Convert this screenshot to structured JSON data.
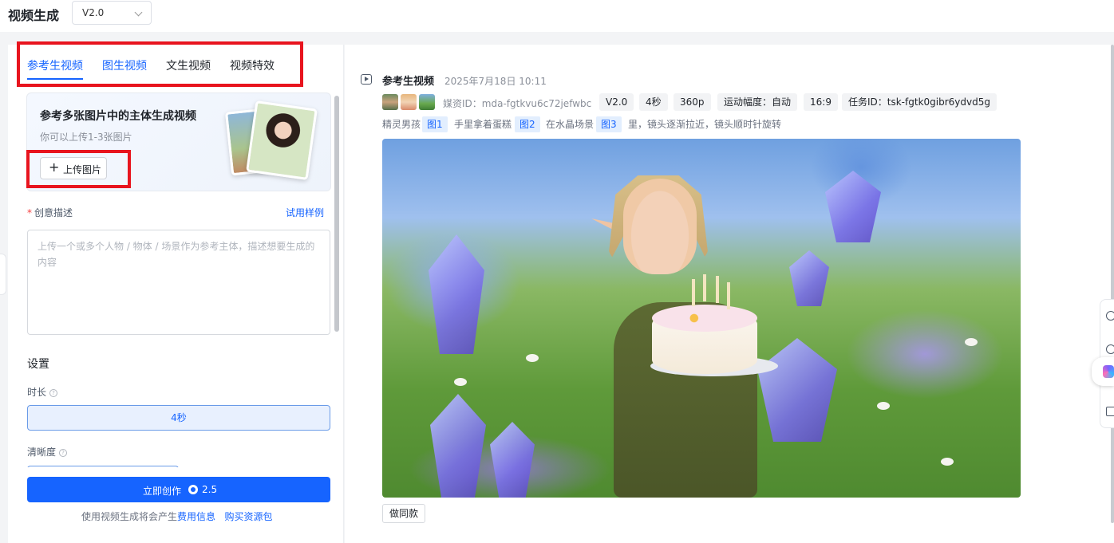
{
  "header": {
    "title": "视频生成",
    "version": "V2.0"
  },
  "tabs": [
    {
      "label": "参考生视频",
      "active": true
    },
    {
      "label": "图生视频",
      "active": false
    },
    {
      "label": "文生视频",
      "active": false
    },
    {
      "label": "视频特效",
      "active": false
    }
  ],
  "reference_card": {
    "title": "参考多张图片中的主体生成视频",
    "subtitle": "你可以上传1-3张图片",
    "upload_label": "上传图片"
  },
  "description": {
    "label": "创意描述",
    "try_example": "试用样例",
    "placeholder": "上传一个或多个人物 / 物体 / 场景作为参考主体，描述想要生成的内容"
  },
  "settings": {
    "title": "设置",
    "duration_label": "时长",
    "duration_value": "4秒",
    "resolution_label": "清晰度"
  },
  "create": {
    "label": "立即创作",
    "cost": "2.5"
  },
  "footer": {
    "prefix": "使用视频生成将会产生",
    "fee_link": "费用信息",
    "buy_link": "购买资源包"
  },
  "task": {
    "title": "参考生视频",
    "time": "2025年7月18日 10:11",
    "media_id": "媒资ID：mda-fgtkvu6c72jefwbc",
    "tags": [
      "V2.0",
      "4秒",
      "360p",
      "运动幅度：自动",
      "16:9",
      "任务ID：tsk-fgtk0gibr6ydvd5g"
    ],
    "prompt": {
      "p1": "精灵男孩",
      "r1": "图1",
      "p2": "手里拿着蛋糕",
      "r2": "图2",
      "p3": "在水晶场景",
      "r3": "图3",
      "p4": "里，镜头逐渐拉近，镜头顺时针旋转"
    },
    "same_button": "做同款"
  },
  "colors": {
    "accent": "#1664ff",
    "highlight_box": "#e8141e"
  },
  "icons": {
    "dropdown": "chevron-down-icon",
    "upload": "plus-icon",
    "task": "video-play-icon",
    "coin": "coin-icon",
    "help": "question-circle-icon"
  }
}
